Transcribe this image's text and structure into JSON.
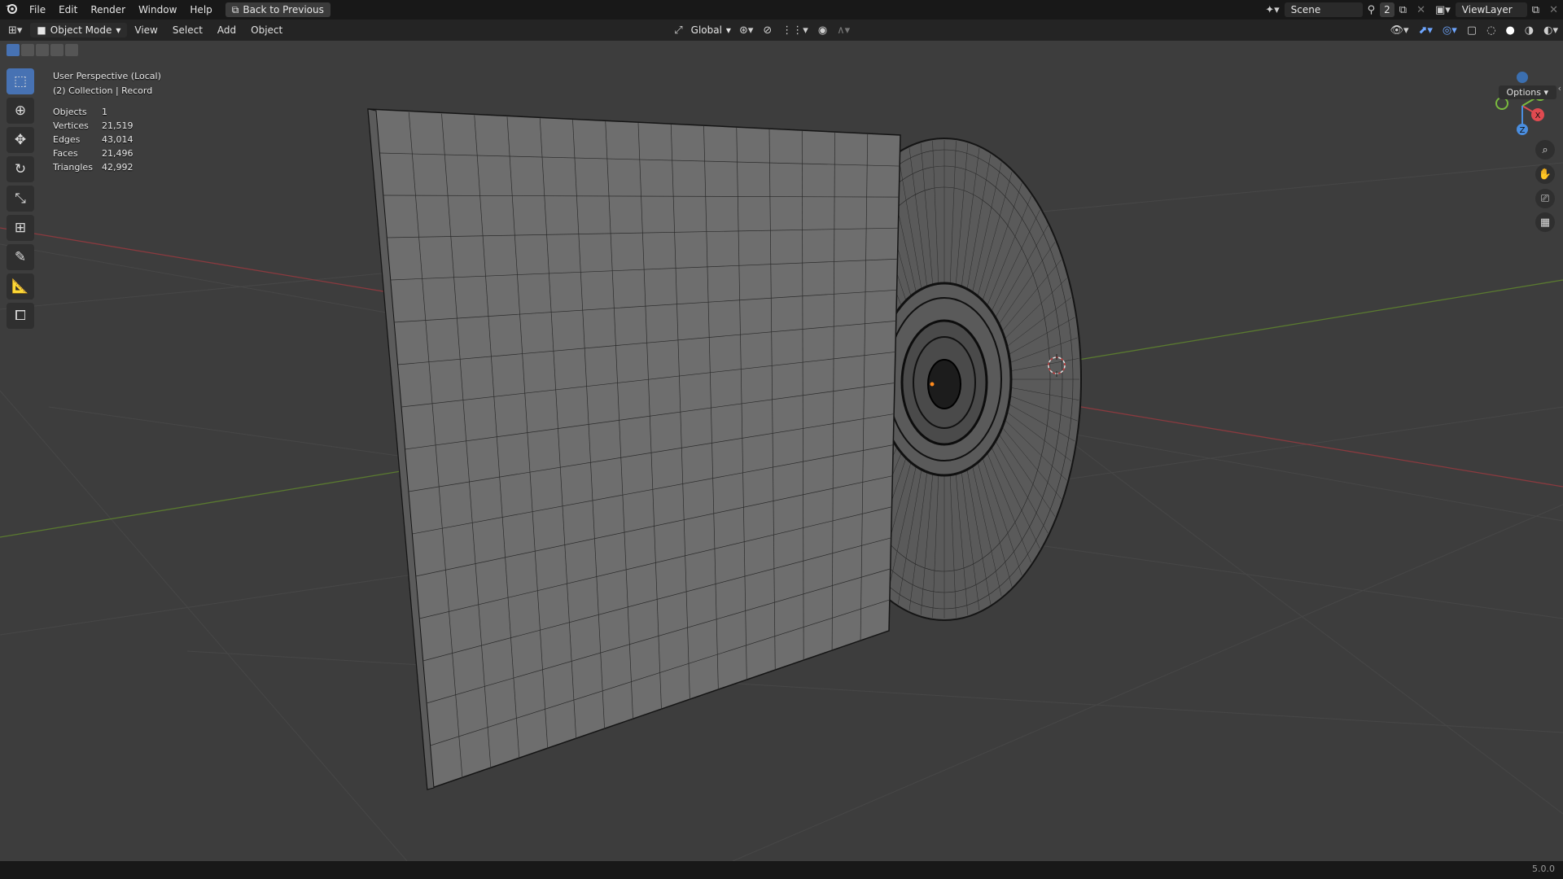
{
  "topbar": {
    "menus": [
      "File",
      "Edit",
      "Render",
      "Window",
      "Help"
    ],
    "back_button": "Back to Previous",
    "scene_label": "Scene",
    "scene_count": "2",
    "view_layer_label": "ViewLayer"
  },
  "header": {
    "mode": "Object Mode",
    "menus": [
      "View",
      "Select",
      "Add",
      "Object"
    ],
    "transform_orientation": "Global"
  },
  "viewport": {
    "perspective_label": "User Perspective (Local)",
    "collection_label": "(2) Collection | Record",
    "stats": [
      {
        "label": "Objects",
        "value": "1"
      },
      {
        "label": "Vertices",
        "value": "21,519"
      },
      {
        "label": "Edges",
        "value": "43,014"
      },
      {
        "label": "Faces",
        "value": "21,496"
      },
      {
        "label": "Triangles",
        "value": "42,992"
      }
    ],
    "options_label": "Options",
    "gizmo_axes": {
      "x": "X",
      "y": "Y",
      "z": "Z"
    }
  },
  "status": {
    "version": "5.0.0"
  },
  "colors": {
    "x_axis": "#b44a4f",
    "y_axis": "#6b8e3a",
    "z_axis": "#3b7fd0",
    "active_blue": "#4772b3"
  }
}
